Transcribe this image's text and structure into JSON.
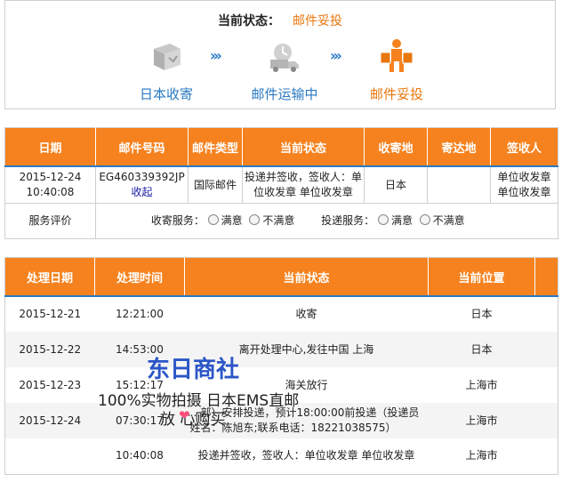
{
  "status": {
    "label": "当前状态：",
    "value": "邮件妥投",
    "steps": [
      {
        "label": "日本收寄",
        "icon": "package-icon"
      },
      {
        "label": "邮件运输中",
        "icon": "delivery-truck-icon"
      },
      {
        "label": "邮件妥投",
        "icon": "delivered-person-icon"
      }
    ],
    "arrow": "›››"
  },
  "mail_table": {
    "headers": [
      "日期",
      "邮件号码",
      "邮件类型",
      "当前状态",
      "收寄地",
      "寄达地",
      "签收人"
    ],
    "row": {
      "date": "2015-12-24 10:40:08",
      "number": "EG460339392JP",
      "collapse_link": "收起",
      "type": "国际邮件",
      "status": "投递并签收，签收人：单位收发章 单位收发章",
      "origin": "日本",
      "destination": "",
      "signer": "单位收发章 单位收发章"
    },
    "rating": {
      "label": "服务评价",
      "groups": [
        {
          "label": "收寄服务：",
          "options": [
            "满意",
            "不满意"
          ]
        },
        {
          "label": "投递服务：",
          "options": [
            "满意",
            "不满意"
          ]
        }
      ]
    }
  },
  "tracking": {
    "headers": [
      "处理日期",
      "处理时间",
      "当前状态",
      "当前位置"
    ],
    "rows": [
      {
        "date": "2015-12-21",
        "time": "12:21:00",
        "status": "收寄",
        "location": "日本"
      },
      {
        "date": "2015-12-22",
        "time": "14:53:00",
        "status": "离开处理中心,发往中国 上海",
        "location": "日本"
      },
      {
        "date": "2015-12-23",
        "time": "15:12:17",
        "status": "海关放行",
        "location": "上海市"
      },
      {
        "date": "2015-12-24",
        "time": "07:30:17",
        "status": "…部）安排投递，预计18:00:00前投递（投递员姓名：陈旭东;联系电话：18221038575）",
        "location": "上海市"
      },
      {
        "date": "",
        "time": "10:40:08",
        "status": "投递并签收，签收人：单位收发章 单位收发章",
        "location": "上海市"
      }
    ]
  },
  "watermark": {
    "line1": "东日商社",
    "line2": "100%实物拍摄 日本EMS直邮",
    "line3": "放 心购买"
  },
  "colors": {
    "orange": "#f5821f",
    "blue": "#2979c3",
    "status_orange": "#e8770e"
  }
}
